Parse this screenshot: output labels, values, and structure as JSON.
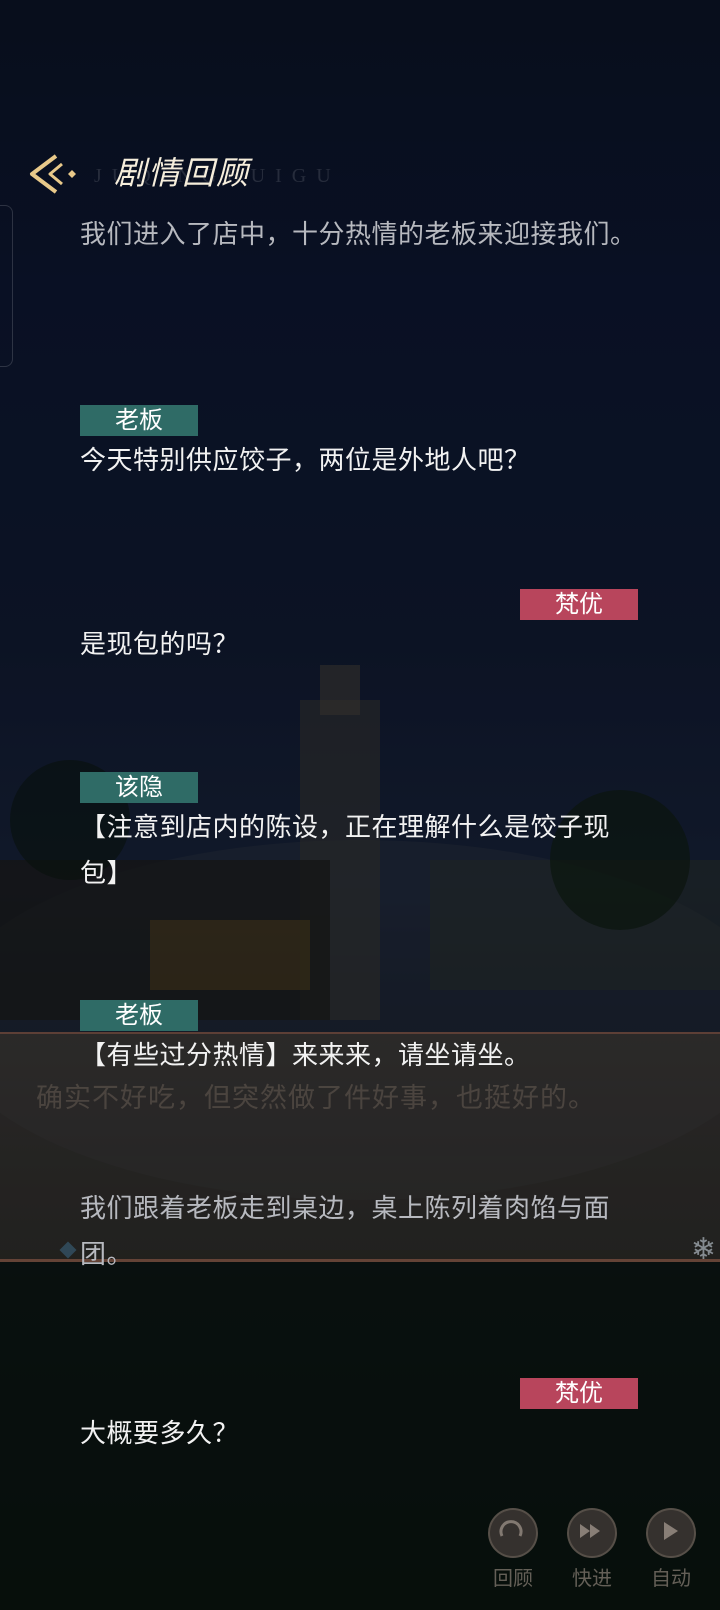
{
  "header": {
    "title": "剧情回顾",
    "subtitle": "JUQINGHUIGU"
  },
  "entries": [
    {
      "speaker": "",
      "text": "我们进入了店中，十分热情的老板来迎接我们。"
    },
    {
      "speaker": "老板",
      "side": "left",
      "text": "今天特别供应饺子，两位是外地人吧？"
    },
    {
      "speaker": "梵优",
      "side": "right",
      "text": "是现包的吗？"
    },
    {
      "speaker": "该隐",
      "side": "left",
      "text": "【注意到店内的陈设，正在理解什么是饺子现包】"
    },
    {
      "speaker": "老板",
      "side": "left",
      "text": "【有些过分热情】来来来，请坐请坐。"
    },
    {
      "speaker": "",
      "text": "我们跟着老板走到桌边，桌上陈列着肉馅与面团。"
    },
    {
      "speaker": "梵优",
      "side": "right",
      "text": "大概要多久？"
    }
  ],
  "game_dialog": {
    "text": "确实不好吃，但突然做了件好事，也挺好的。"
  },
  "controls": {
    "review_label": "回顾",
    "fast_label": "快进",
    "auto_label": "自动"
  },
  "colors": {
    "left_tag": "#2f6b66",
    "right_tag": "#b8455c"
  }
}
